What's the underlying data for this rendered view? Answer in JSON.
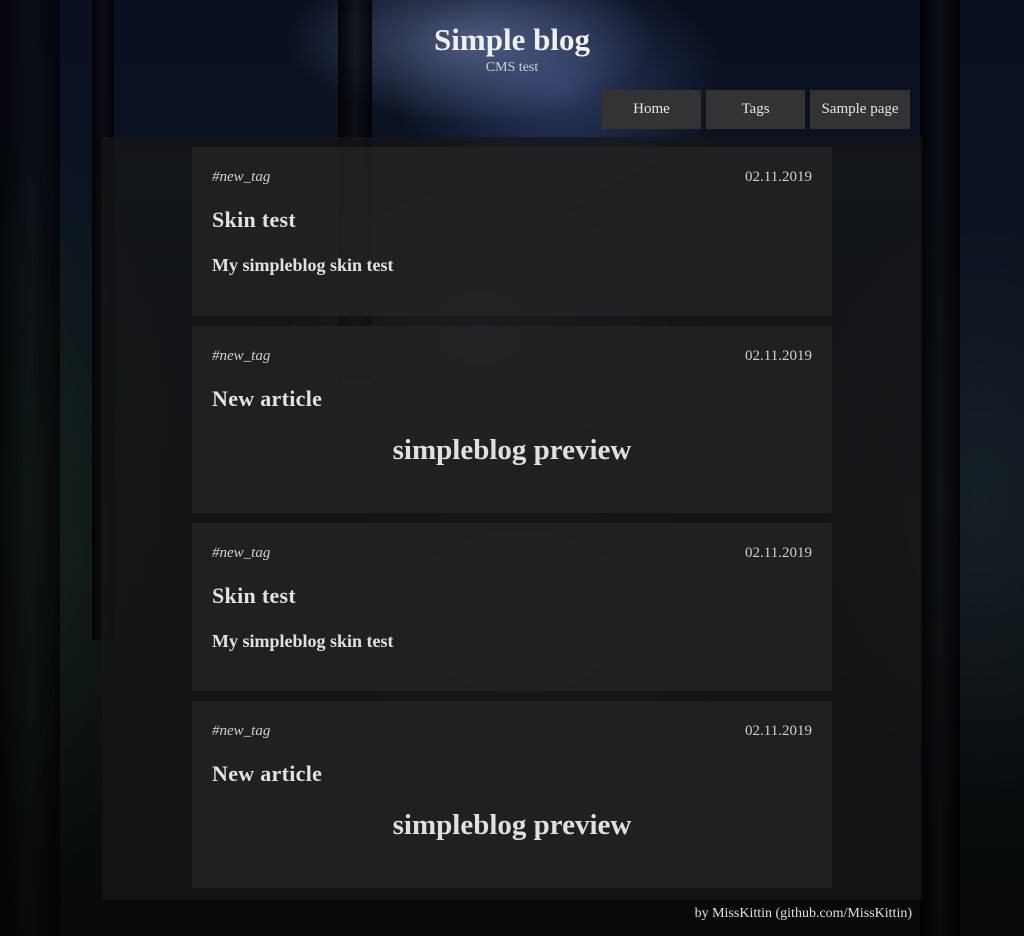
{
  "site": {
    "title": "Simple blog",
    "subtitle": "CMS test"
  },
  "nav": {
    "items": [
      {
        "label": "Home"
      },
      {
        "label": "Tags"
      },
      {
        "label": "Sample page"
      }
    ]
  },
  "articles": [
    {
      "tag": "#new_tag",
      "date": "02.11.2019",
      "title": "Skin test",
      "summary": "My simpleblog skin test"
    },
    {
      "tag": "#new_tag",
      "date": "02.11.2019",
      "title": "New article",
      "preview_heading": "simpleblog preview"
    },
    {
      "tag": "#new_tag",
      "date": "02.11.2019",
      "title": "Skin test",
      "summary": "My simpleblog skin test"
    },
    {
      "tag": "#new_tag",
      "date": "02.11.2019",
      "title": "New article",
      "preview_heading": "simpleblog preview"
    }
  ],
  "footer": {
    "credit": "by MissKittin (github.com/MissKittin)"
  },
  "colors": {
    "nav_background": "#333333",
    "content_panel": "#161616",
    "article_card": "#242424",
    "text": "#d8d8d8"
  }
}
